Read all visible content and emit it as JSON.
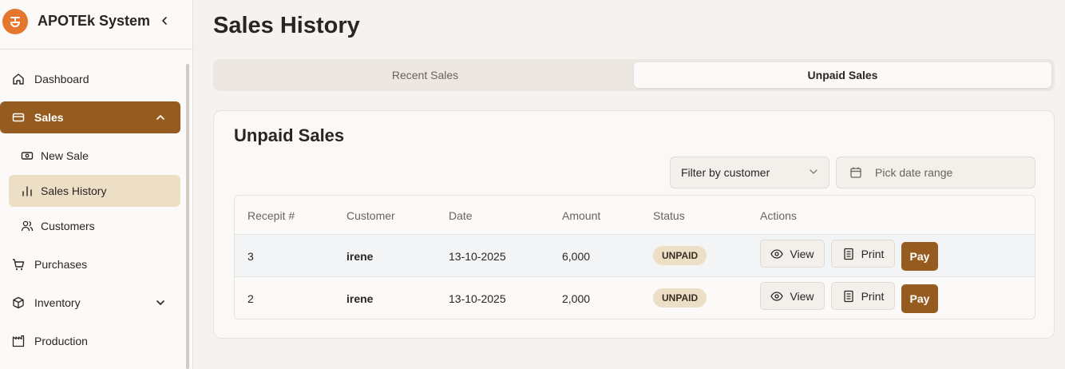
{
  "app": {
    "name": "APOTEk System"
  },
  "colors": {
    "accent": "#965c1f",
    "accent_light": "#ecdfc6",
    "logo": "#e5772d"
  },
  "sidebar": {
    "items": [
      {
        "label": "Dashboard",
        "icon": "home-icon"
      },
      {
        "label": "Sales",
        "icon": "card-icon",
        "active": true,
        "expanded": true,
        "children": [
          {
            "label": "New Sale",
            "icon": "cash-icon"
          },
          {
            "label": "Sales History",
            "icon": "bar-chart-icon",
            "current": true
          },
          {
            "label": "Customers",
            "icon": "users-icon"
          }
        ]
      },
      {
        "label": "Purchases",
        "icon": "cart-icon"
      },
      {
        "label": "Inventory",
        "icon": "package-icon",
        "expandable": true
      },
      {
        "label": "Production",
        "icon": "factory-icon"
      }
    ]
  },
  "page": {
    "title": "Sales History"
  },
  "tabs": [
    {
      "label": "Recent Sales",
      "selected": false
    },
    {
      "label": "Unpaid Sales",
      "selected": true
    }
  ],
  "card": {
    "title": "Unpaid Sales",
    "filter": {
      "value": "Filter by customer"
    },
    "date_range": {
      "placeholder": "Pick date range"
    }
  },
  "table": {
    "columns": [
      "Recepit #",
      "Customer",
      "Date",
      "Amount",
      "Status",
      "Actions"
    ],
    "rows": [
      {
        "receipt": "3",
        "customer": "irene",
        "date": "13-10-2025",
        "amount": "6,000",
        "status": "UNPAID"
      },
      {
        "receipt": "2",
        "customer": "irene",
        "date": "13-10-2025",
        "amount": "2,000",
        "status": "UNPAID"
      }
    ],
    "actions": {
      "view": "View",
      "print": "Print",
      "pay": "Pay"
    }
  }
}
